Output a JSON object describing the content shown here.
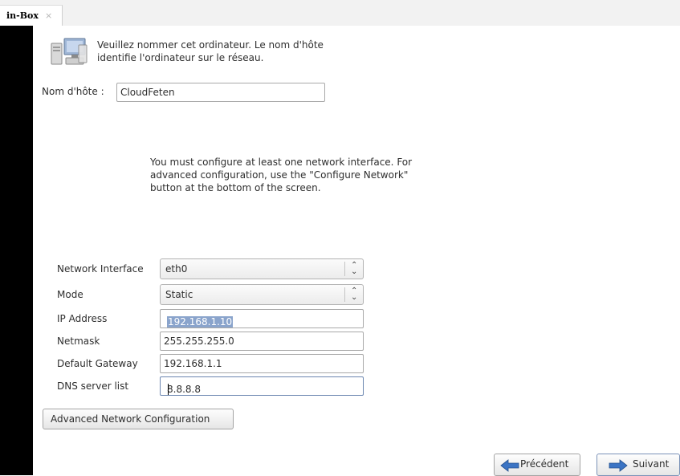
{
  "tab": {
    "label": "in-Box",
    "close": "×"
  },
  "header": {
    "description": "Veuillez nommer cet ordinateur.  Le nom d'hôte identifie l'ordinateur sur le réseau."
  },
  "hostname": {
    "label": "Nom d'hôte :",
    "value": "CloudFeten"
  },
  "info": "You must configure at least one network interface.  For advanced configuration, use the \"Configure Network\" button at the bottom of the screen.",
  "network": {
    "interface_label": "Network Interface",
    "interface_value": "eth0",
    "mode_label": "Mode",
    "mode_value": "Static",
    "ip_label": "IP Address",
    "ip_value": "192.168.1.10",
    "netmask_label": "Netmask",
    "netmask_value": "255.255.255.0",
    "gateway_label": "Default Gateway",
    "gateway_value": "192.168.1.1",
    "dns_label": "DNS server list",
    "dns_value": "8.8.8.8"
  },
  "buttons": {
    "advanced": "Advanced Network Configuration",
    "previous": "Précédent",
    "next": "Suivant"
  },
  "icons": {
    "host": "computer-network-icon",
    "previous": "arrow-left-icon",
    "next": "arrow-right-icon"
  },
  "colors": {
    "selection": "#8aa4cc",
    "arrow_blue": "#3b74c4"
  }
}
